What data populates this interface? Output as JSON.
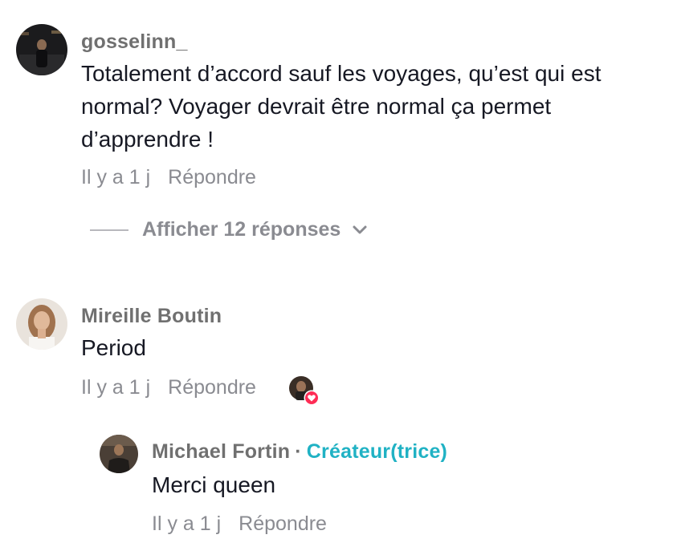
{
  "comments": [
    {
      "username": "gosselinn_",
      "text_lines": [
        "Totalement d’accord sauf les voyages, qu’est qui est",
        "normal? Voyager devrait être normal ça permet",
        "d’apprendre !"
      ],
      "time": "Il y a 1 j",
      "reply_label": "Répondre",
      "view_replies_label": "Afficher 12 réponses"
    },
    {
      "username": "Mireille Boutin",
      "text": "Period",
      "time": "Il y a 1 j",
      "reply_label": "Répondre"
    }
  ],
  "reply": {
    "username": "Michael Fortin",
    "separator": "·",
    "badge": "Créateur(trice)",
    "text": "Merci queen",
    "time": "Il y a 1 j",
    "reply_label": "Répondre"
  },
  "icons": {
    "chevron": "chevron-down-icon",
    "heart": "heart-icon"
  },
  "colors": {
    "creator_badge": "#20b2c4",
    "heart": "#fe2c55",
    "meta": "#8a8b91",
    "username": "#707070"
  }
}
